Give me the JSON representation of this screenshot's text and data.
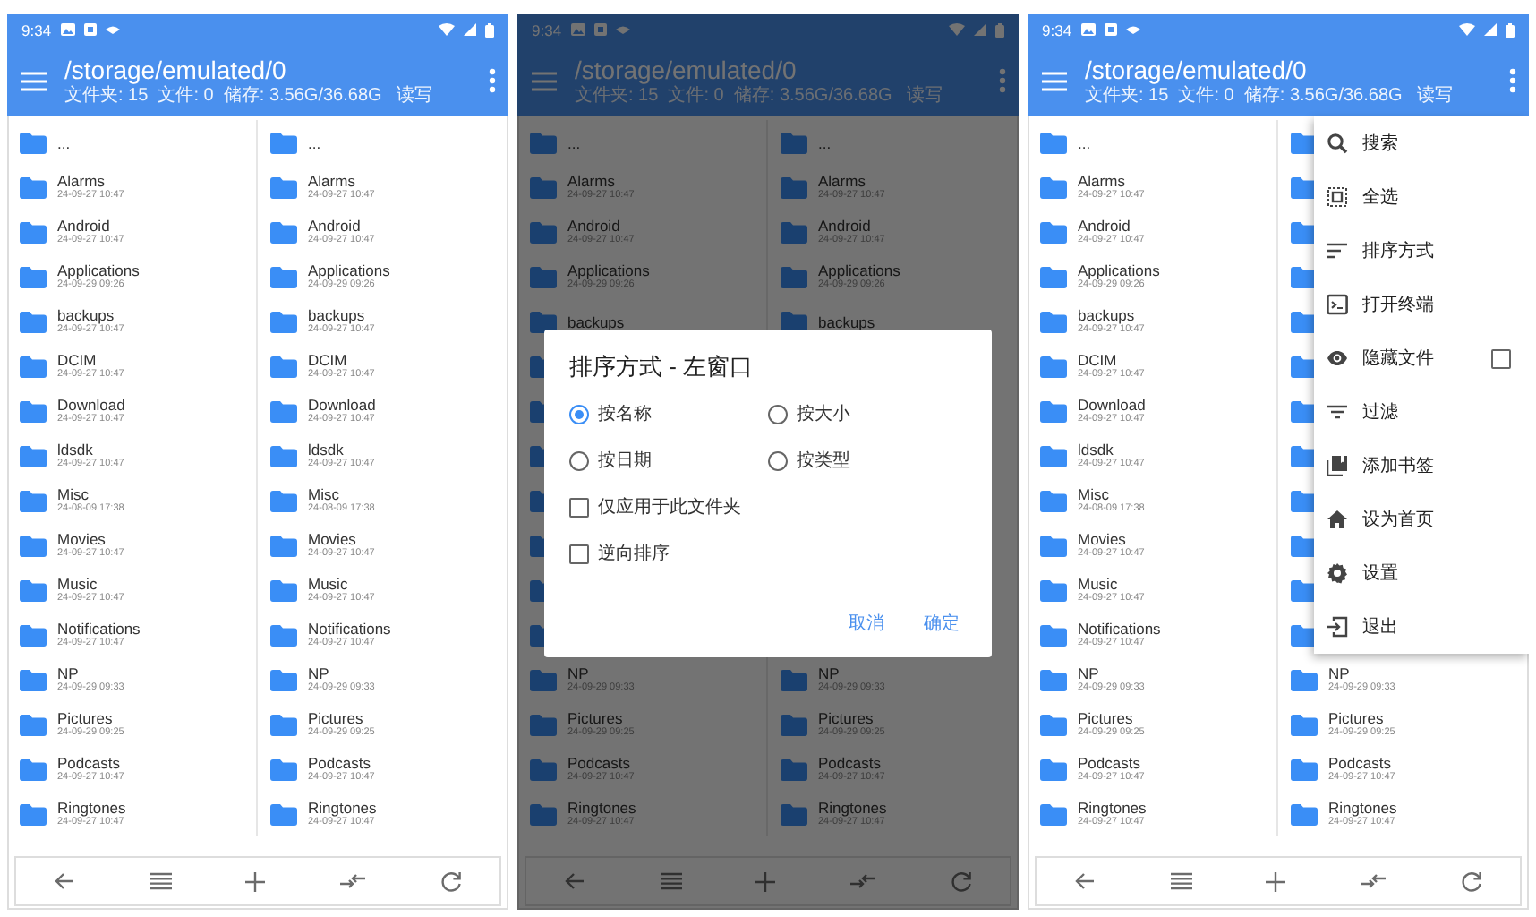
{
  "screens": [
    {
      "status_bar": {
        "time": "9:34"
      },
      "app_bar": {
        "title": "/storage/emulated/0",
        "stats": "文件夹: 15  文件: 0  储存: 3.56G/36.68G",
        "access": "读写"
      },
      "panes": [
        {
          "rows": [
            {
              "name": "..."
            },
            {
              "name": "Alarms",
              "date": "24-09-27 10:47"
            },
            {
              "name": "Android",
              "date": "24-09-27 10:47"
            },
            {
              "name": "Applications",
              "date": "24-09-29 09:26"
            },
            {
              "name": "backups",
              "date": "24-09-27 10:47"
            },
            {
              "name": "DCIM",
              "date": "24-09-27 10:47"
            },
            {
              "name": "Download",
              "date": "24-09-27 10:47"
            },
            {
              "name": "ldsdk",
              "date": "24-09-27 10:47"
            },
            {
              "name": "Misc",
              "date": "24-08-09 17:38"
            },
            {
              "name": "Movies",
              "date": "24-09-27 10:47"
            },
            {
              "name": "Music",
              "date": "24-09-27 10:47"
            },
            {
              "name": "Notifications",
              "date": "24-09-27 10:47"
            },
            {
              "name": "NP",
              "date": "24-09-29 09:33"
            },
            {
              "name": "Pictures",
              "date": "24-09-29 09:25"
            },
            {
              "name": "Podcasts",
              "date": "24-09-27 10:47"
            },
            {
              "name": "Ringtones",
              "date": "24-09-27 10:47"
            }
          ]
        },
        {
          "rows": [
            {
              "name": "..."
            },
            {
              "name": "Alarms",
              "date": "24-09-27 10:47"
            },
            {
              "name": "Android",
              "date": "24-09-27 10:47"
            },
            {
              "name": "Applications",
              "date": "24-09-29 09:26"
            },
            {
              "name": "backups",
              "date": "24-09-27 10:47"
            },
            {
              "name": "DCIM",
              "date": "24-09-27 10:47"
            },
            {
              "name": "Download",
              "date": "24-09-27 10:47"
            },
            {
              "name": "ldsdk",
              "date": "24-09-27 10:47"
            },
            {
              "name": "Misc",
              "date": "24-08-09 17:38"
            },
            {
              "name": "Movies",
              "date": "24-09-27 10:47"
            },
            {
              "name": "Music",
              "date": "24-09-27 10:47"
            },
            {
              "name": "Notifications",
              "date": "24-09-27 10:47"
            },
            {
              "name": "NP",
              "date": "24-09-29 09:33"
            },
            {
              "name": "Pictures",
              "date": "24-09-29 09:25"
            },
            {
              "name": "Podcasts",
              "date": "24-09-27 10:47"
            },
            {
              "name": "Ringtones",
              "date": "24-09-27 10:47"
            }
          ]
        }
      ]
    },
    {
      "status_bar": {
        "time": "9:34"
      },
      "app_bar": {
        "title": "/storage/emulated/0",
        "stats": "文件夹: 15  文件: 0  储存: 3.56G/36.68G",
        "access": "读写"
      },
      "panes": [
        {
          "rows": [
            {
              "name": "..."
            },
            {
              "name": "Alarms",
              "date": "24-09-27 10:47"
            },
            {
              "name": "Android",
              "date": "24-09-27 10:47"
            },
            {
              "name": "Applications",
              "date": "24-09-29 09:26"
            },
            {
              "name": "backups"
            },
            {},
            {},
            {},
            {},
            {},
            {},
            {},
            {
              "name": "NP",
              "date": "24-09-29 09:33"
            },
            {
              "name": "Pictures",
              "date": "24-09-29 09:25"
            },
            {
              "name": "Podcasts",
              "date": "24-09-27 10:47"
            },
            {
              "name": "Ringtones",
              "date": "24-09-27 10:47"
            }
          ]
        },
        {
          "rows": [
            {
              "name": "..."
            },
            {
              "name": "Alarms",
              "date": "24-09-27 10:47"
            },
            {
              "name": "Android",
              "date": "24-09-27 10:47"
            },
            {
              "name": "Applications",
              "date": "24-09-29 09:26"
            },
            {
              "name": "backups"
            }
          ],
          "rows_below": [
            {
              "name": "NP",
              "date": "24-09-29 09:33"
            },
            {
              "name": "Pictures",
              "date": "24-09-29 09:25"
            },
            {
              "name": "Podcasts",
              "date": "24-09-27 10:47"
            },
            {
              "name": "Ringtones",
              "date": "24-09-27 10:47"
            }
          ]
        }
      ],
      "dialog": {
        "title": "排序方式 - 左窗口",
        "options": [
          {
            "label": "按名称",
            "selected": true
          },
          {
            "label": "按大小",
            "selected": false
          },
          {
            "label": "按日期",
            "selected": false
          },
          {
            "label": "按类型",
            "selected": false
          }
        ],
        "checkboxes": [
          {
            "label": "仅应用于此文件夹",
            "checked": false
          },
          {
            "label": "逆向排序",
            "checked": false
          }
        ],
        "buttons": [
          "取消",
          "确定"
        ]
      }
    },
    {
      "status_bar": {
        "time": "9:34"
      },
      "app_bar": {
        "title": "/storage/emulated/0",
        "stats": "文件夹: 15  文件: 0  储存: 3.56G/36.68G",
        "access": "读写"
      },
      "panes": [
        {
          "rows": [
            {
              "name": "..."
            },
            {
              "name": "Alarms",
              "date": "24-09-27 10:47"
            },
            {
              "name": "Android",
              "date": "24-09-27 10:47"
            },
            {
              "name": "Applications",
              "date": "24-09-29 09:26"
            },
            {
              "name": "backups",
              "date": "24-09-27 10:47"
            },
            {
              "name": "DCIM",
              "date": "24-09-27 10:47"
            },
            {
              "name": "Download",
              "date": "24-09-27 10:47"
            },
            {
              "name": "ldsdk",
              "date": "24-09-27 10:47"
            },
            {
              "name": "Misc",
              "date": "24-08-09 17:38"
            },
            {
              "name": "Movies",
              "date": "24-09-27 10:47"
            },
            {
              "name": "Music",
              "date": "24-09-27 10:47"
            },
            {
              "name": "Notifications",
              "date": "24-09-27 10:47"
            },
            {
              "name": "NP",
              "date": "24-09-29 09:33"
            },
            {
              "name": "Pictures",
              "date": "24-09-29 09:25"
            },
            {
              "name": "Podcasts",
              "date": "24-09-27 10:47"
            },
            {
              "name": "Ringtones",
              "date": "24-09-27 10:47"
            }
          ]
        },
        {
          "rows": [
            {},
            {},
            {},
            {},
            {},
            {},
            {},
            {},
            {},
            {},
            {},
            {},
            {
              "name": "NP",
              "date": "24-09-29 09:33"
            },
            {
              "name": "Pictures",
              "date": "24-09-29 09:25"
            },
            {
              "name": "Podcasts",
              "date": "24-09-27 10:47"
            },
            {
              "name": "Ringtones",
              "date": "24-09-27 10:47"
            }
          ]
        }
      ],
      "menu": [
        {
          "kind": "action",
          "label": "搜索"
        },
        {
          "kind": "action",
          "label": "全选"
        },
        {
          "kind": "action",
          "label": "排序方式"
        },
        {
          "kind": "action",
          "label": "打开终端"
        },
        {
          "kind": "checkbox",
          "label": "隐藏文件",
          "checked": false
        },
        {
          "kind": "action",
          "label": "过滤"
        },
        {
          "kind": "action",
          "label": "添加书签"
        },
        {
          "kind": "action",
          "label": "设为首页"
        },
        {
          "kind": "action",
          "label": "设置"
        },
        {
          "kind": "action",
          "label": "退出"
        }
      ]
    }
  ]
}
